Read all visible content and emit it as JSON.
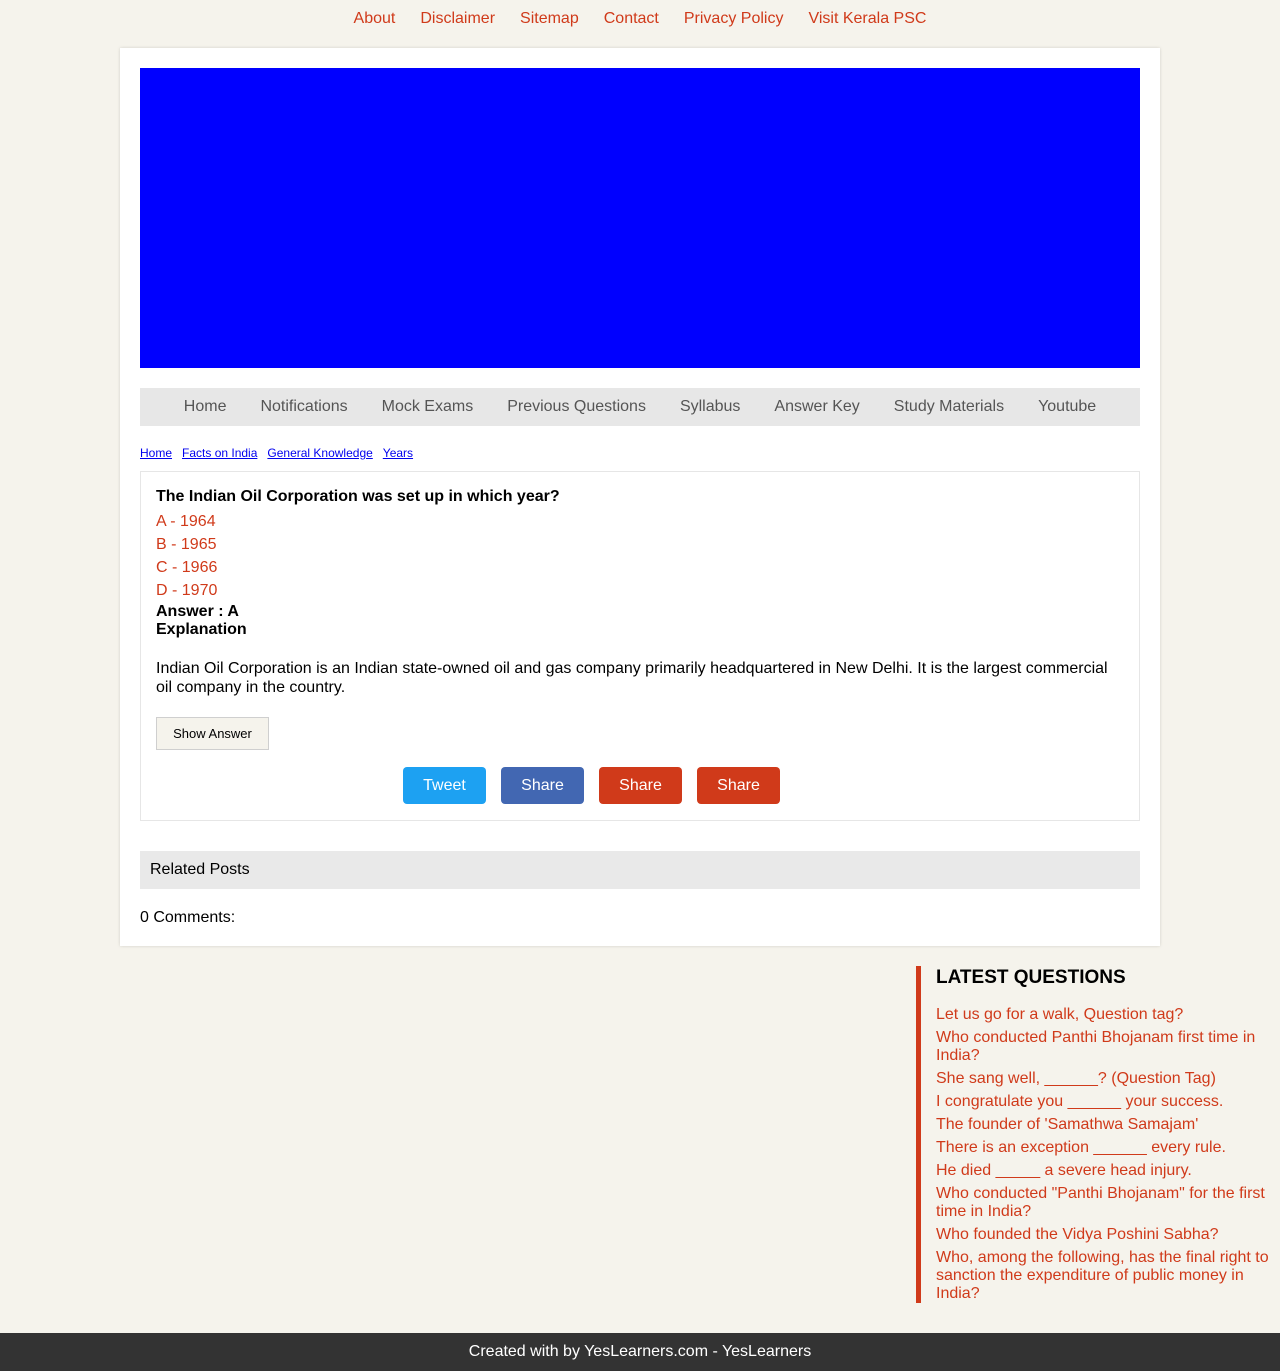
{
  "top_links": [
    "About",
    "Disclaimer",
    "Sitemap",
    "Contact",
    "Privacy Policy",
    "Visit Kerala PSC"
  ],
  "nav": [
    "Home",
    "Notifications",
    "Mock Exams",
    "Previous Questions",
    "Syllabus",
    "Answer Key",
    "Study Materials",
    "Youtube"
  ],
  "breadcrumb": [
    "Home",
    "Facts on India",
    "General Knowledge",
    "Years"
  ],
  "question": {
    "title": "The Indian Oil Corporation was set up in which year?",
    "options": [
      "A - 1964",
      "B - 1965",
      "C - 1966",
      "D - 1970"
    ],
    "answer": "Answer : A",
    "explanation_label": "Explanation",
    "explanation": "Indian Oil Corporation is an Indian state-owned oil and gas company primarily headquartered in New Delhi. It is the largest commercial oil company in the country.",
    "show_answer_label": "Show Answer"
  },
  "share_buttons": [
    {
      "label": "Tweet",
      "color": "#1da1f2"
    },
    {
      "label": "Share",
      "color": "#4267b2"
    },
    {
      "label": "Share",
      "color": "#d03a1a"
    },
    {
      "label": "Share",
      "color": "#d03a1a"
    }
  ],
  "related_posts_label": "Related Posts",
  "comments_label": "0 Comments:",
  "sidebar": {
    "heading": "LATEST QUESTIONS",
    "items": [
      "Let us go for a walk, Question tag?",
      "Who conducted Panthi Bhojanam first time in India?",
      "She sang well, ______? (Question Tag)",
      "I congratulate you ______ your success.",
      "The founder of 'Samathwa Samajam'",
      "There is an exception ______ every rule.",
      "He died _____ a severe head injury.",
      "Who conducted \"Panthi Bhojanam\" for the first time in India?",
      "Who founded the Vidya Poshini Sabha?",
      "Who, among the following, has the final right to sanction the expenditure of public money in India?"
    ]
  },
  "footer": "Created with by YesLearners.com - YesLearners",
  "colors": {
    "accent": "#d03a1a",
    "banner": "#0000ff",
    "background": "#f5f3ec",
    "footer": "#333333"
  }
}
